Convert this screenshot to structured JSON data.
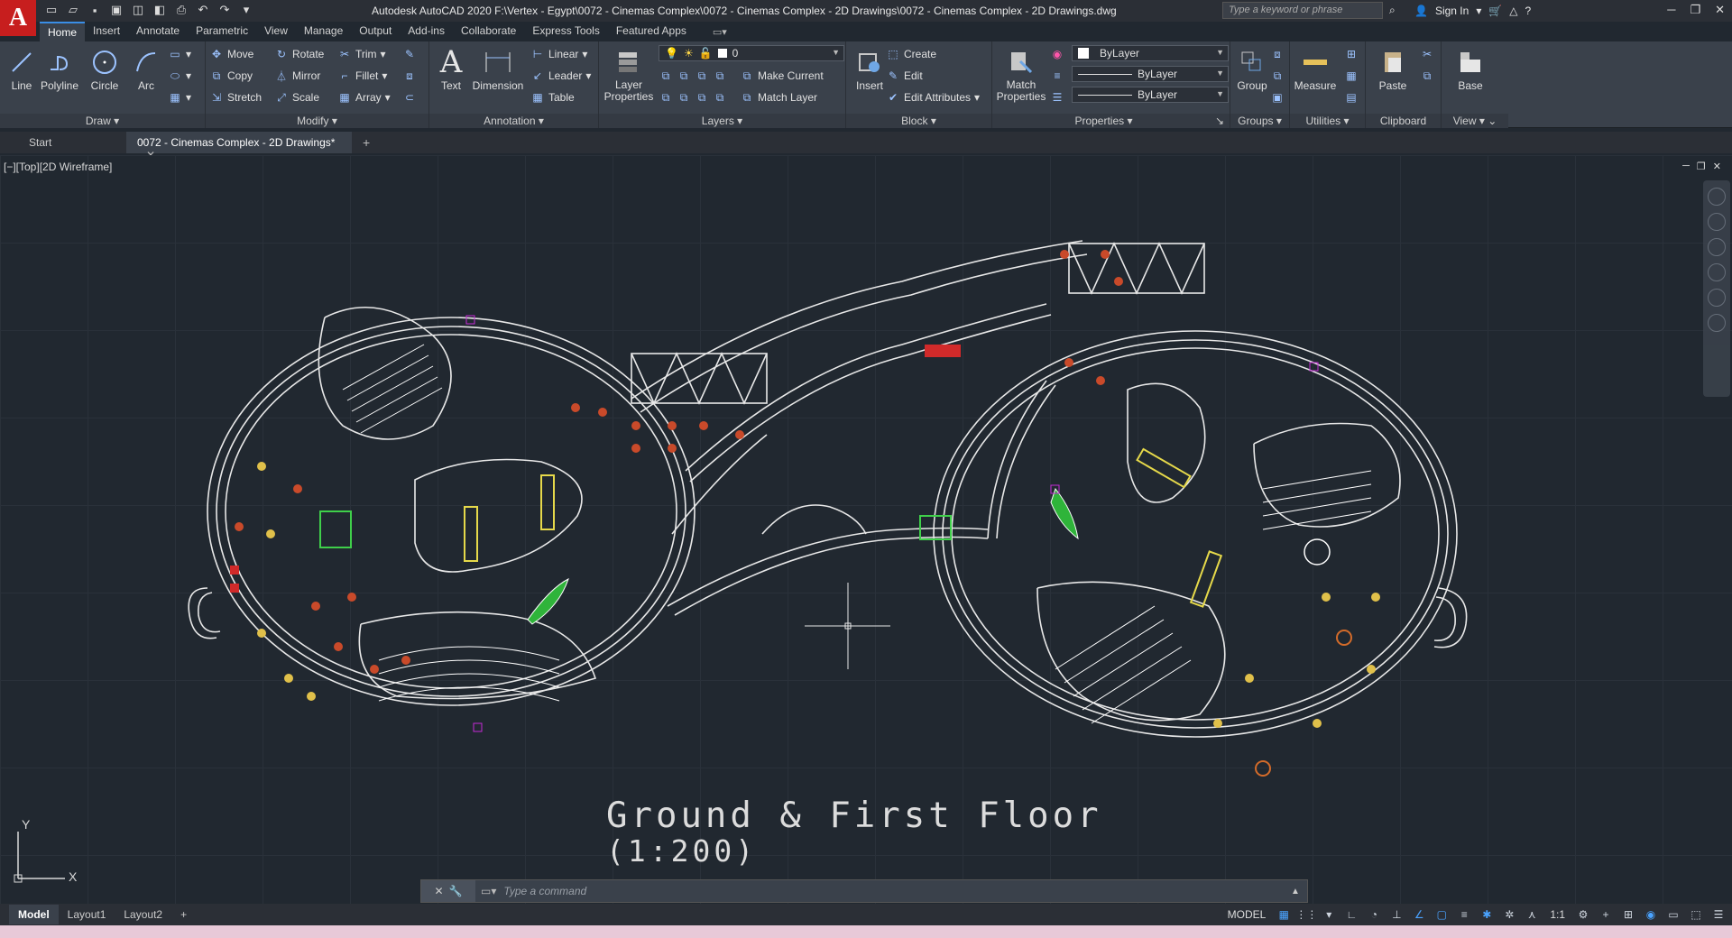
{
  "app": {
    "logo": "A",
    "title": "Autodesk AutoCAD 2020   F:\\Vertex - Egypt\\0072 - Cinemas Complex\\0072 - Cinemas Complex - 2D Drawings\\0072 - Cinemas Complex - 2D Drawings.dwg",
    "search_placeholder": "Type a keyword or phrase",
    "sign_in": "Sign In"
  },
  "ribbon_tabs": [
    "Home",
    "Insert",
    "Annotate",
    "Parametric",
    "View",
    "Manage",
    "Output",
    "Add-ins",
    "Collaborate",
    "Express Tools",
    "Featured Apps"
  ],
  "panels": {
    "draw": {
      "label": "Draw",
      "tools": [
        "Line",
        "Polyline",
        "Circle",
        "Arc"
      ]
    },
    "modify": {
      "label": "Modify",
      "tools": [
        "Move",
        "Rotate",
        "Trim",
        "Copy",
        "Mirror",
        "Fillet",
        "Stretch",
        "Scale",
        "Array"
      ]
    },
    "annotation": {
      "label": "Annotation",
      "tools": [
        "Text",
        "Dimension",
        "Linear",
        "Leader",
        "Table"
      ]
    },
    "layers": {
      "label": "Layers",
      "tools": [
        "Layer Properties",
        "Make Current",
        "Match Layer"
      ],
      "current_layer": "0"
    },
    "block": {
      "label": "Block",
      "tools": [
        "Insert",
        "Create",
        "Edit",
        "Edit Attributes"
      ]
    },
    "properties": {
      "label": "Properties",
      "tools": [
        "Match Properties"
      ],
      "color": "ByLayer",
      "linetype": "ByLayer",
      "lineweight": "ByLayer"
    },
    "groups": {
      "label": "Groups",
      "tools": [
        "Group"
      ]
    },
    "utilities": {
      "label": "Utilities",
      "tools": [
        "Measure"
      ]
    },
    "clipboard": {
      "label": "Clipboard",
      "tools": [
        "Paste"
      ]
    },
    "view": {
      "label": "View",
      "tools": [
        "Base"
      ]
    }
  },
  "doc_tabs": {
    "start": "Start",
    "active": "0072 - Cinemas Complex - 2D Drawings*"
  },
  "viewport": {
    "label": "[−][Top][2D Wireframe]"
  },
  "drawing": {
    "title": "Ground & First Floor",
    "scale": "(1:200)"
  },
  "ucs": {
    "x": "X",
    "y": "Y"
  },
  "command": {
    "placeholder": "Type a command"
  },
  "layout_tabs": [
    "Model",
    "Layout1",
    "Layout2"
  ],
  "status": {
    "mode": "MODEL",
    "scale": "1:1"
  }
}
